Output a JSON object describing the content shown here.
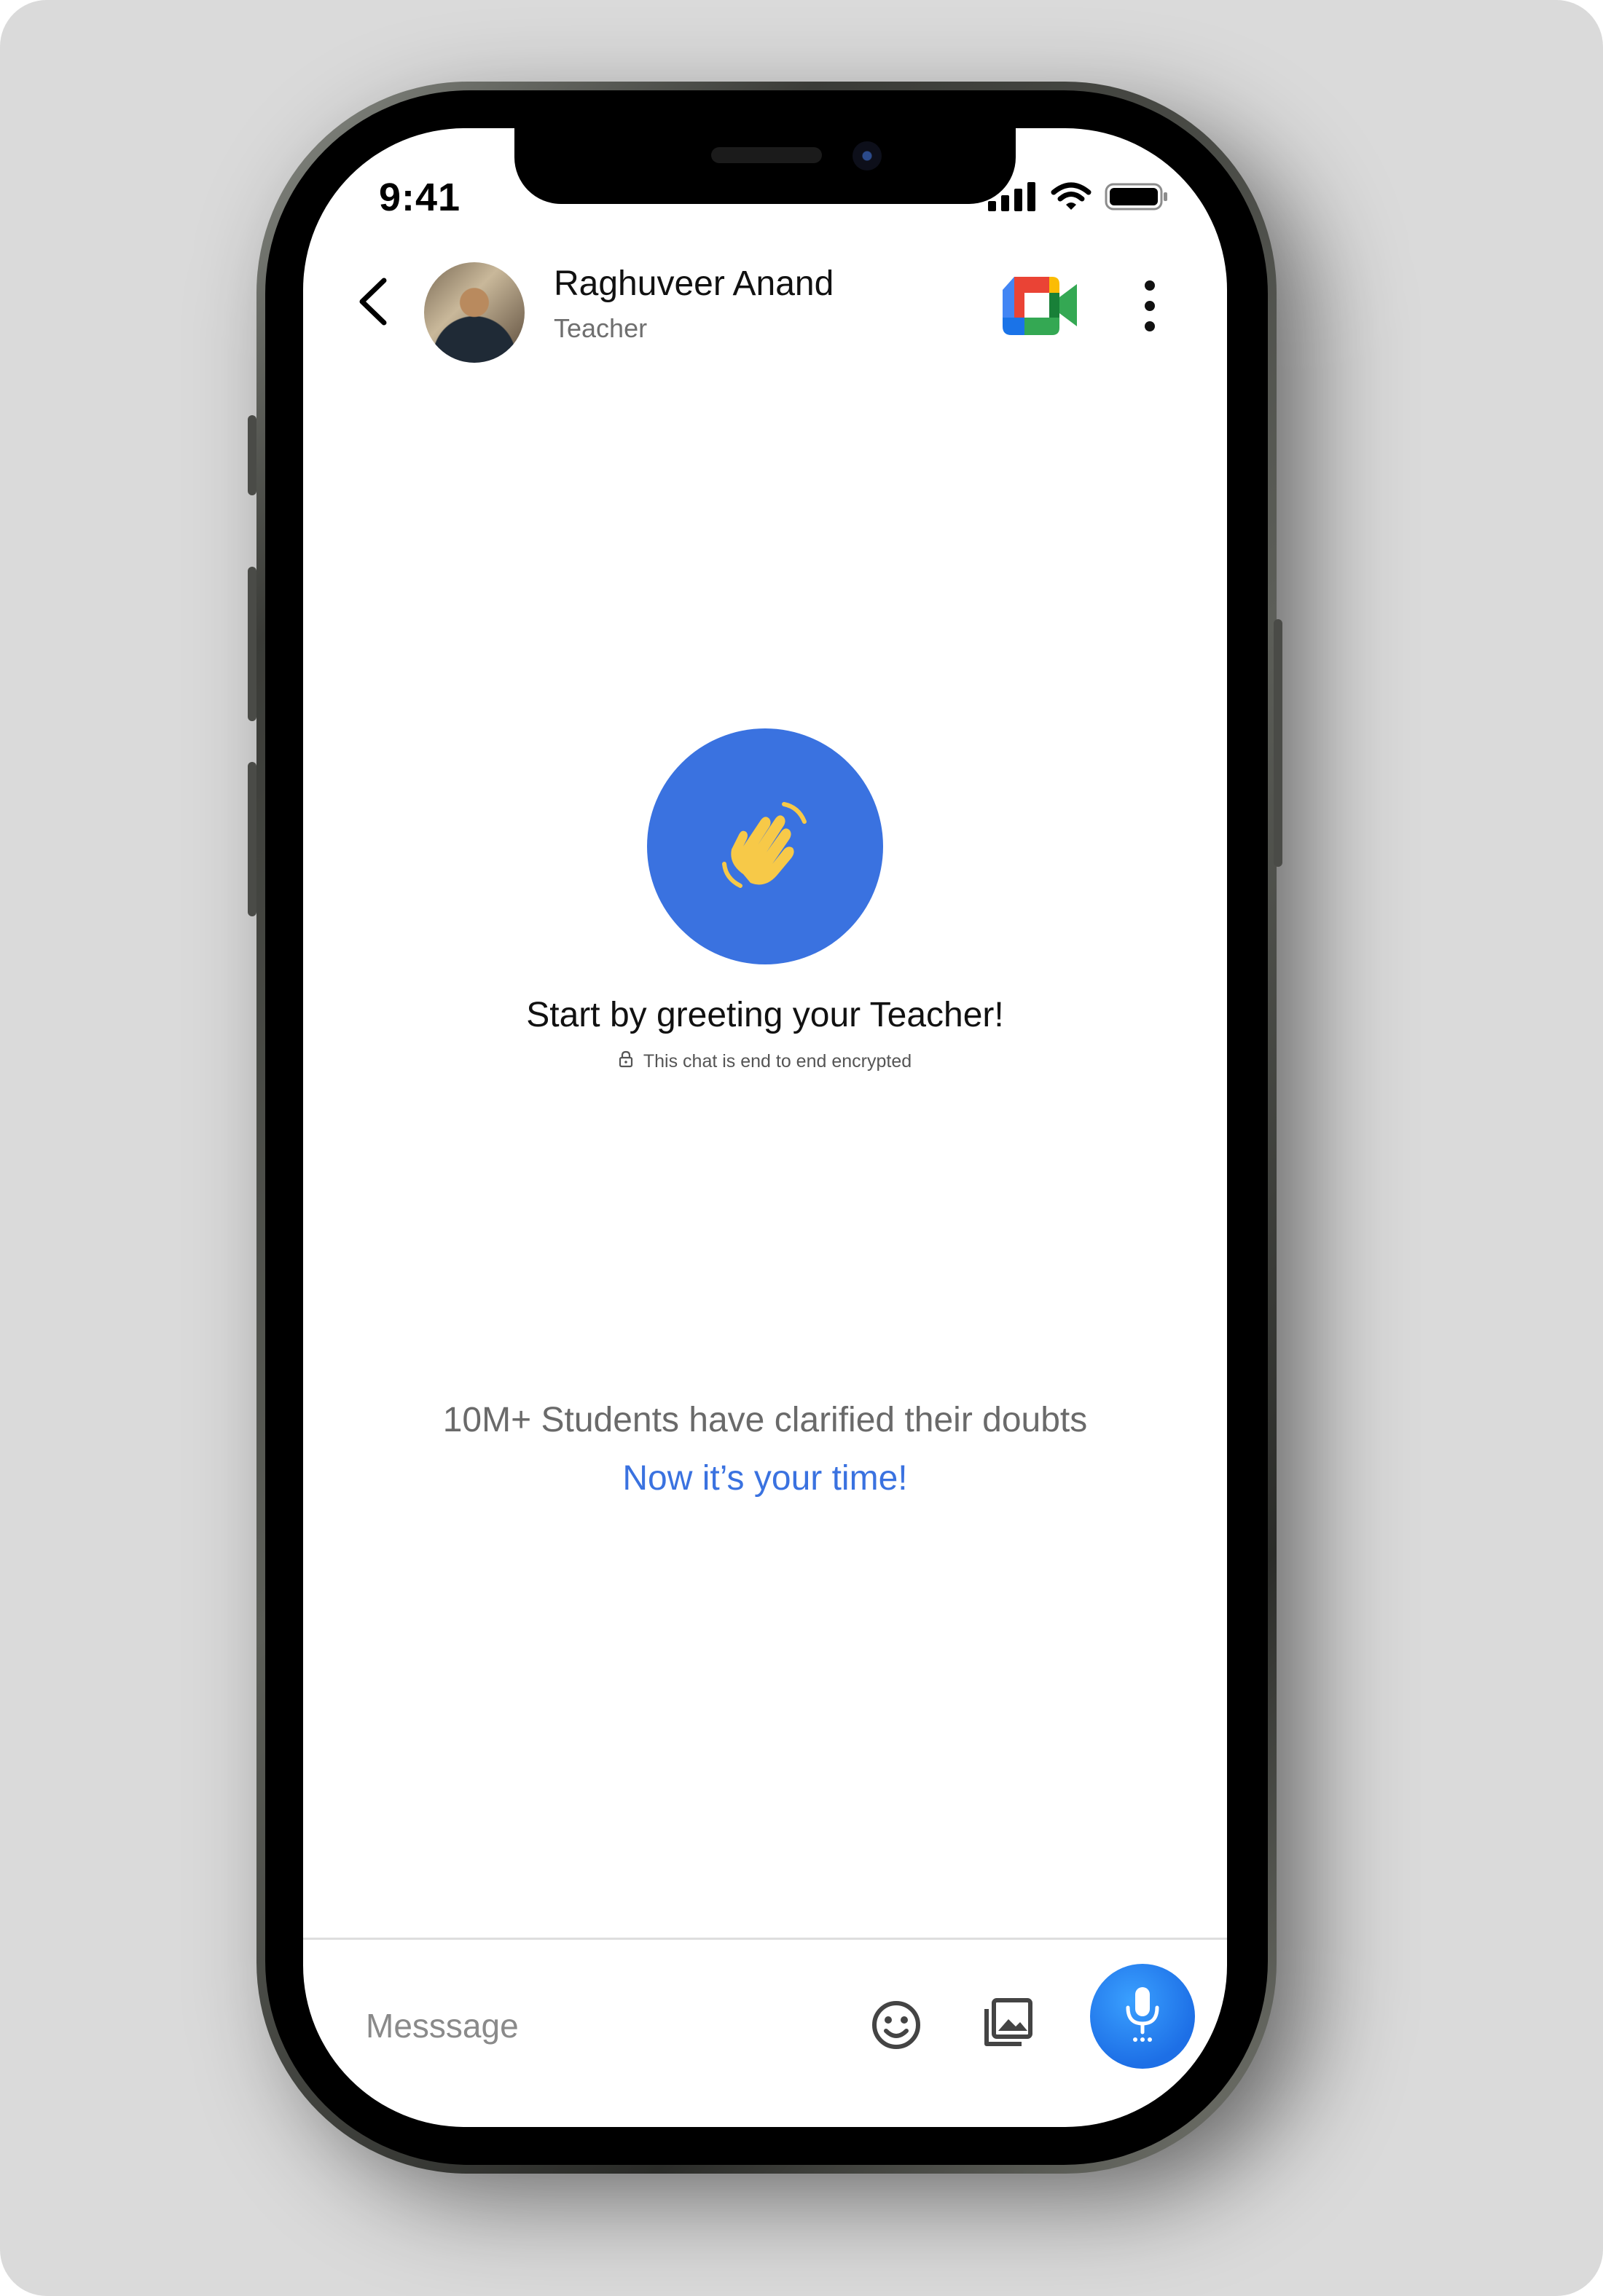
{
  "status_bar": {
    "time": "9:41",
    "icons": [
      "signal-icon",
      "wifi-icon",
      "battery-icon"
    ]
  },
  "header": {
    "contact_name": "Raghuveer Anand",
    "contact_role": "Teacher",
    "icons": [
      "back-icon",
      "google-meet-icon",
      "more-vertical-icon"
    ]
  },
  "empty_state": {
    "icon": "waving-hand-icon",
    "title": "Start by greeting your Teacher!",
    "encryption_note": "This chat is end to end encrypted",
    "encryption_icon": "lock-icon"
  },
  "promo": {
    "stat_text": "10M+ Students have clarified their doubts",
    "cta_text": "Now it’s your time!"
  },
  "composer": {
    "placeholder": "Messsage",
    "icons": [
      "emoji-icon",
      "gallery-icon",
      "microphone-icon"
    ]
  },
  "colors": {
    "accent": "#3a72e0",
    "mic_button": "#1d6fe6",
    "wave_hand": "#f7c948",
    "background": "#dadada"
  }
}
